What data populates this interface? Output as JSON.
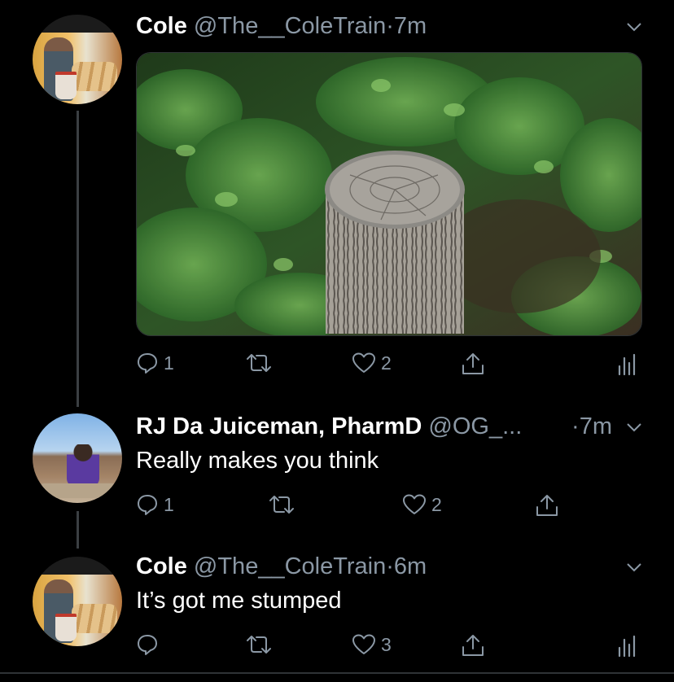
{
  "tweets": [
    {
      "name": "Cole",
      "handle": "@The__ColeTrain",
      "separator": "·",
      "time": "7m",
      "text": "",
      "has_media": true,
      "actions": {
        "replies": "1",
        "retweets": "",
        "likes": "2"
      },
      "has_analytics": true
    },
    {
      "name": "RJ Da Juiceman, PharmD",
      "handle": "@OG_...",
      "separator": "·",
      "time": "7m",
      "text": "Really makes you think",
      "has_media": false,
      "actions": {
        "replies": "1",
        "retweets": "",
        "likes": "2"
      },
      "has_analytics": false
    },
    {
      "name": "Cole",
      "handle": "@The__ColeTrain",
      "separator": "·",
      "time": "6m",
      "text": "It’s got me stumped",
      "has_media": false,
      "actions": {
        "replies": "",
        "retweets": "",
        "likes": "3"
      },
      "has_analytics": true
    }
  ],
  "icons": {
    "reply": "reply-icon",
    "retweet": "retweet-icon",
    "like": "heart-icon",
    "share": "share-icon",
    "analytics": "analytics-icon",
    "more": "chevron-down-icon"
  },
  "colors": {
    "background": "#000000",
    "secondary_text": "#8b98a5",
    "thread_line": "#3b3f43"
  }
}
